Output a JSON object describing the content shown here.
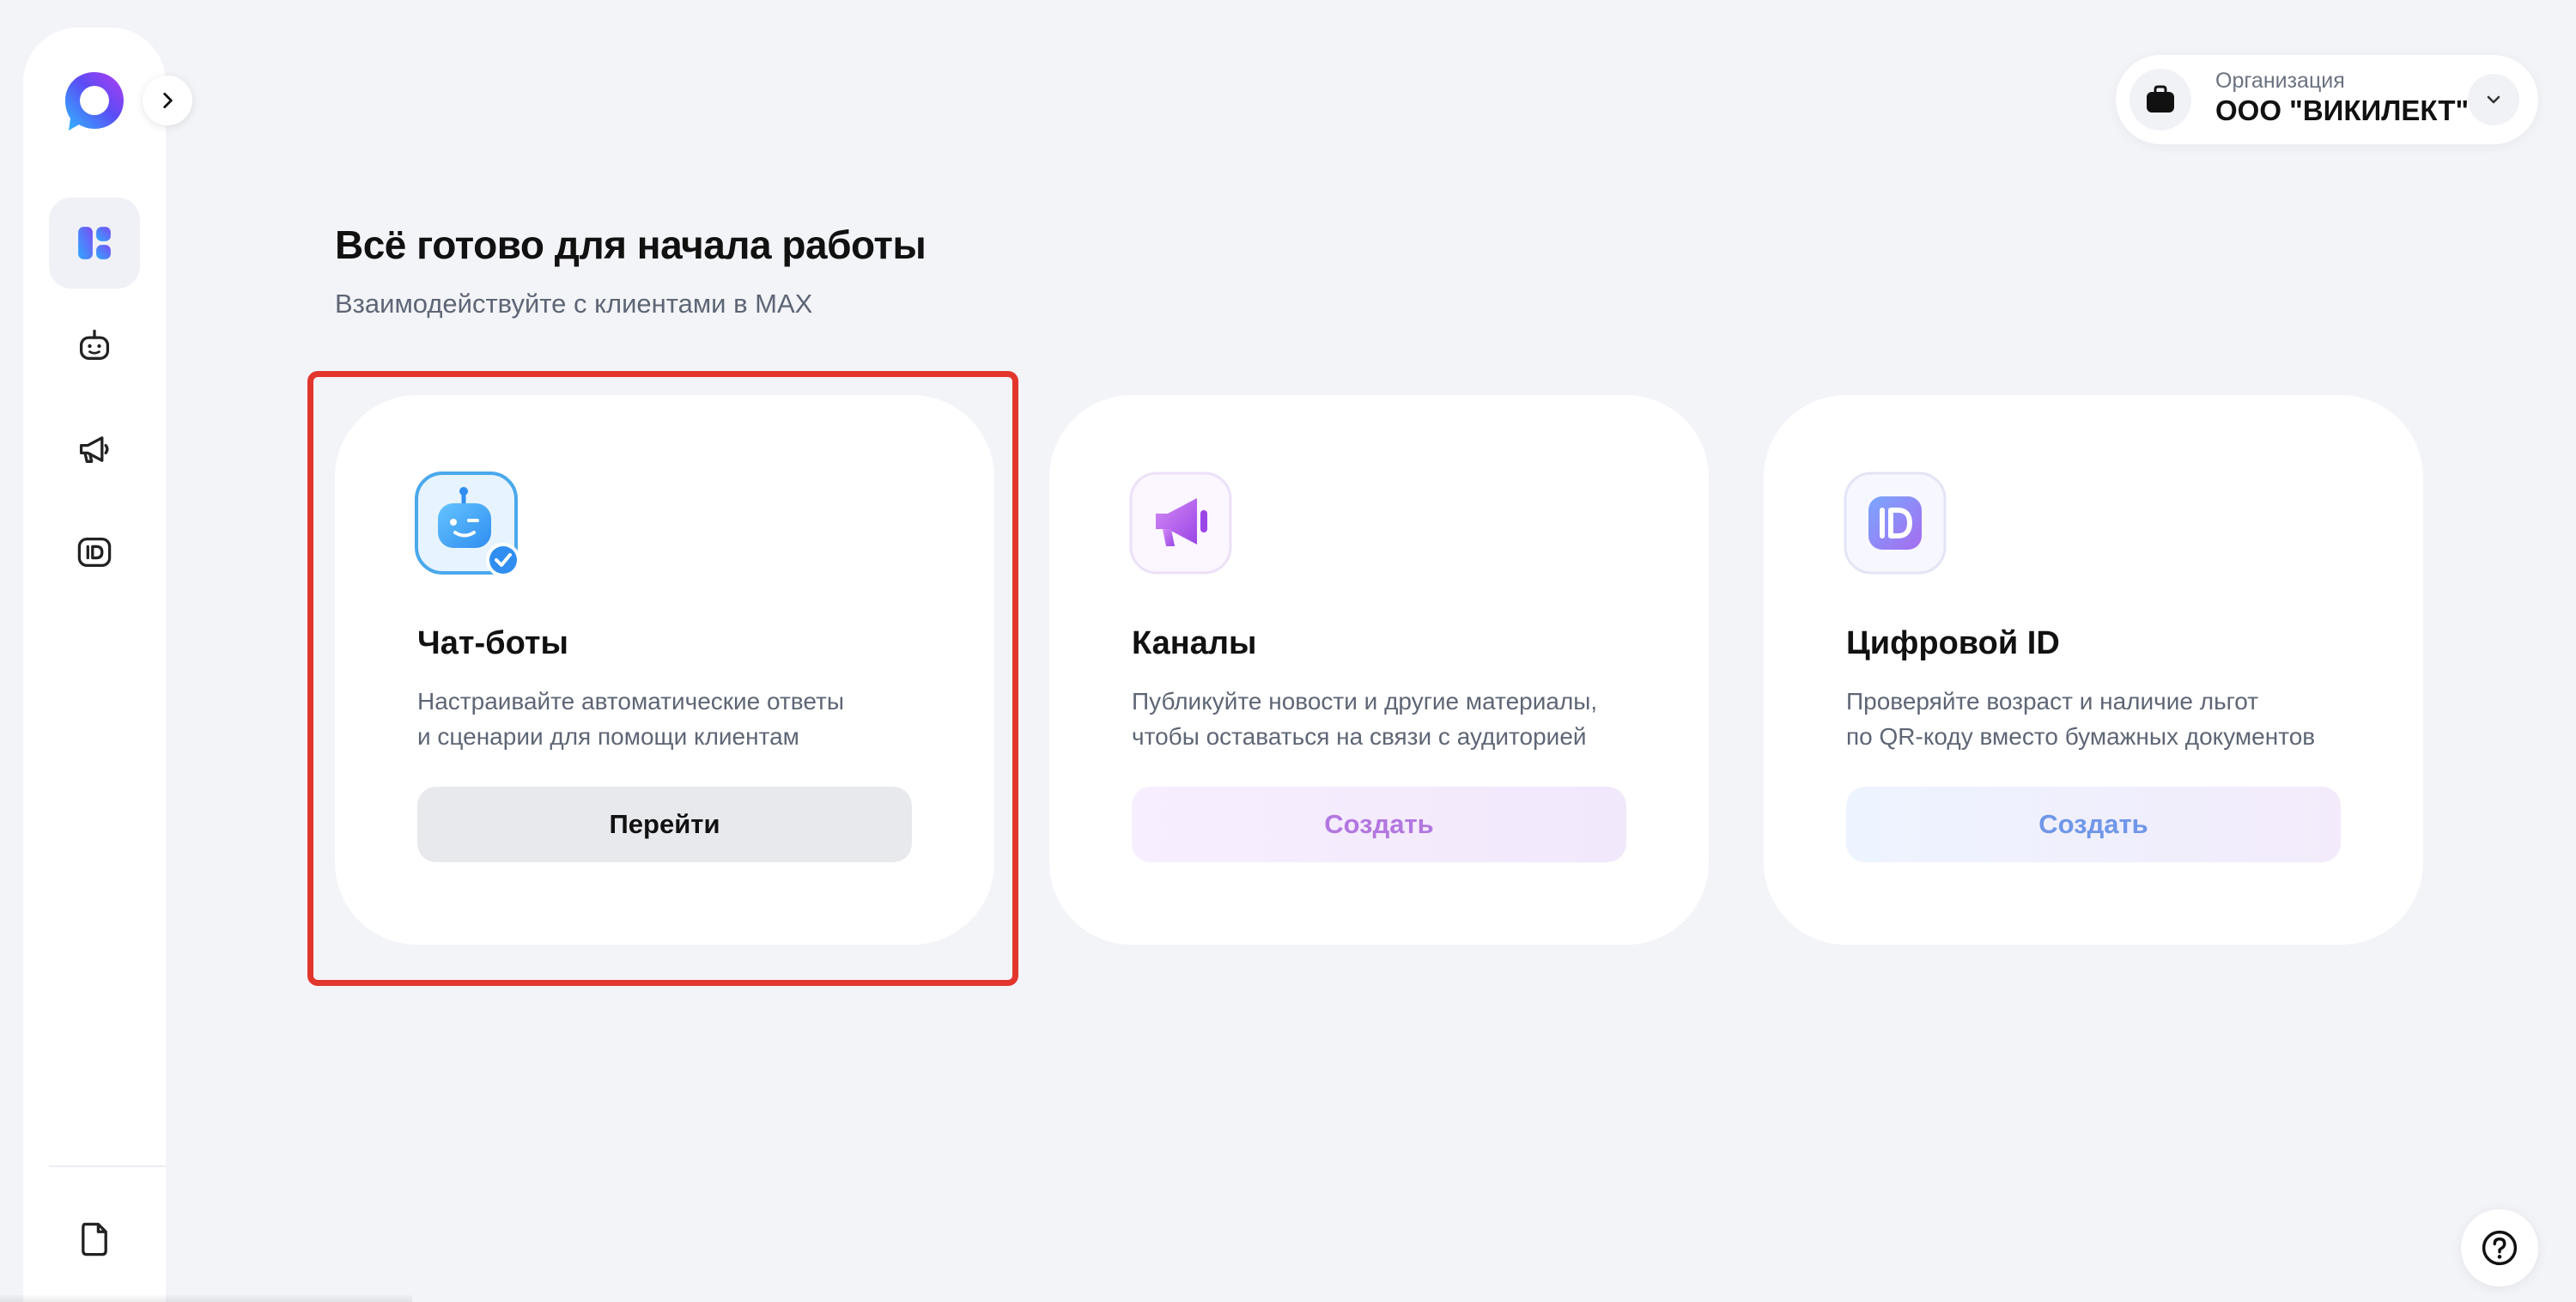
{
  "sidebar": {
    "items": [
      {
        "icon": "dashboard-icon",
        "active": true
      },
      {
        "icon": "bot-icon",
        "active": false
      },
      {
        "icon": "megaphone-icon",
        "active": false
      },
      {
        "icon": "id-icon",
        "active": false
      }
    ],
    "bottom_icon": "document-icon"
  },
  "header": {
    "org_label": "Организация",
    "org_name": "ООО \"ВИКИЛЕКТ\""
  },
  "main": {
    "title": "Всё готово для начала работы",
    "subtitle": "Взаимодействуйте с клиентами в MAX",
    "cards": [
      {
        "title": "Чат-боты",
        "desc_line1": "Настраивайте автоматические ответы",
        "desc_line2": "и сценарии для помощи клиентам",
        "button": "Перейти",
        "icon": "chatbot-icon"
      },
      {
        "title": "Каналы",
        "desc_line1": "Публикуйте новости и другие материалы,",
        "desc_line2": "чтобы оставаться на связи с аудиторией",
        "button": "Создать",
        "icon": "channels-megaphone-icon"
      },
      {
        "title": "Цифровой ID",
        "desc_line1": "Проверяйте возраст и наличие льгот",
        "desc_line2": "по QR-коду вместо бумажных документов",
        "button": "Создать",
        "icon": "digital-id-icon"
      }
    ]
  },
  "colors": {
    "background": "#f3f4f8",
    "highlight": "#e2362c",
    "accent_purple": "#b277df",
    "accent_blue": "#6f96e8"
  }
}
